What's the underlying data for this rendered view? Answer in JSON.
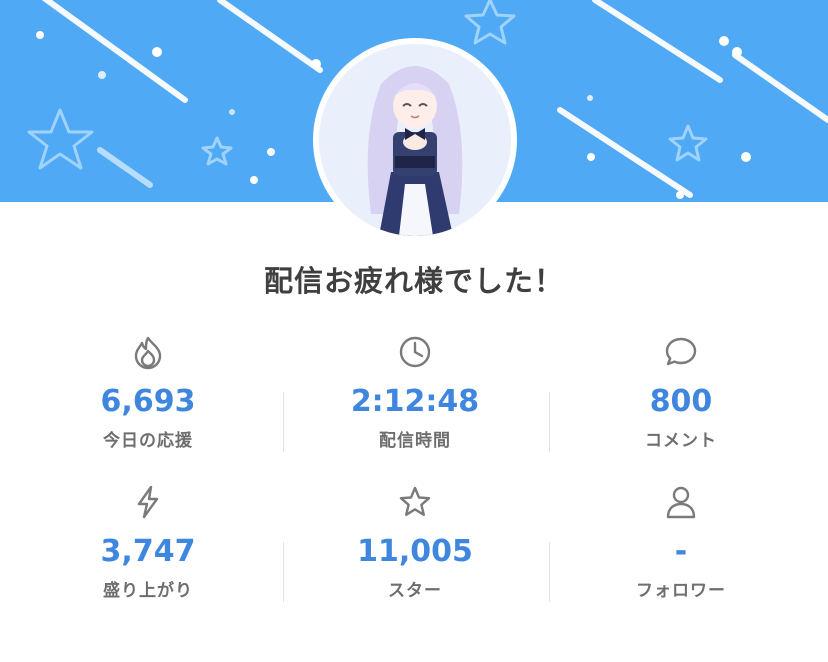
{
  "header": {
    "title": "配信お疲れ様でした！",
    "banner_color": "#4fa9f5"
  },
  "avatar": {
    "description_icon": "avatar"
  },
  "stats": [
    {
      "icon": "flame-icon",
      "value": "6,693",
      "label": "今日の応援"
    },
    {
      "icon": "clock-icon",
      "value": "2:12:48",
      "label": "配信時間"
    },
    {
      "icon": "comment-icon",
      "value": "800",
      "label": "コメント"
    },
    {
      "icon": "lightning-icon",
      "value": "3,747",
      "label": "盛り上がり"
    },
    {
      "icon": "star-icon",
      "value": "11,005",
      "label": "スター"
    },
    {
      "icon": "person-icon",
      "value": "-",
      "label": "フォロワー"
    }
  ],
  "colors": {
    "value": "#3f86de",
    "label": "#6e6e6e",
    "icon": "#7a7a7a"
  }
}
